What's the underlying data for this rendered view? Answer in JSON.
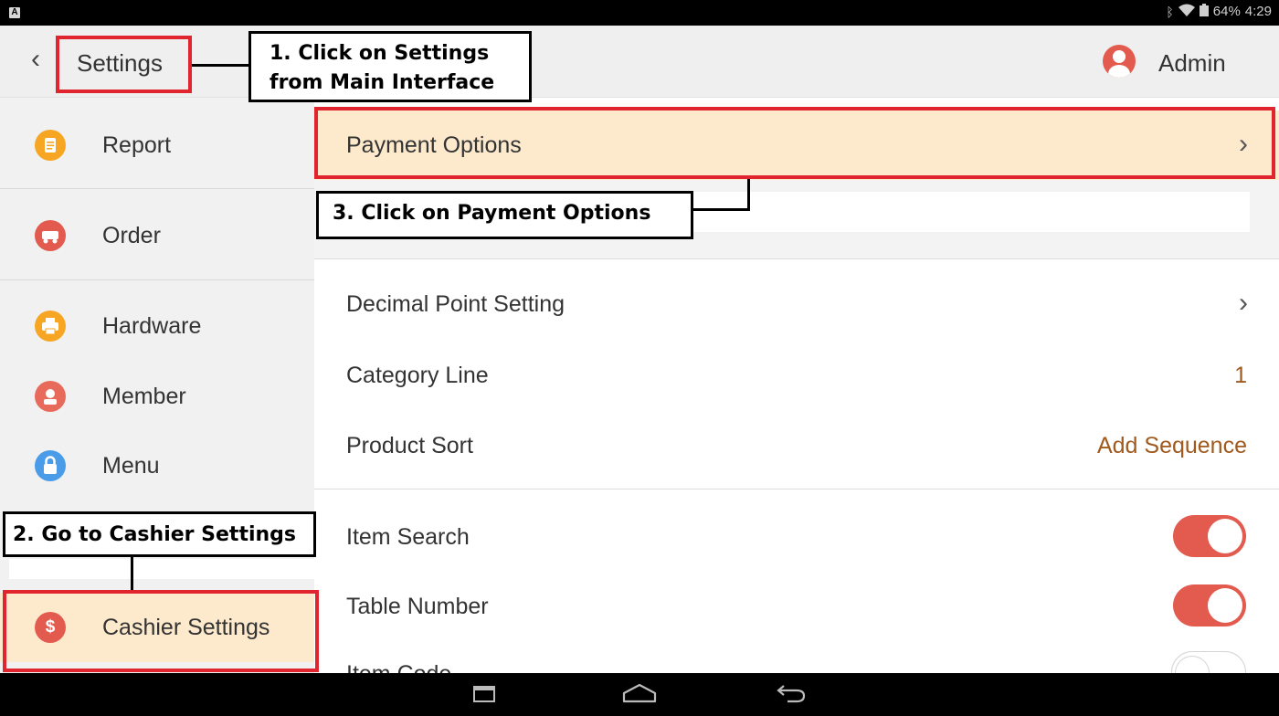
{
  "status_bar": {
    "battery": "64%",
    "time": "4:29",
    "notification_glyph": "A"
  },
  "header": {
    "back_icon": "‹",
    "title": "Settings",
    "user_name": "Admin"
  },
  "sidebar": {
    "items": [
      {
        "label": "Report",
        "icon": "report-icon",
        "color": "#f6a623",
        "glyph": "≡"
      },
      {
        "label": "Order",
        "icon": "order-icon",
        "color": "#e25b4e",
        "glyph": "✦"
      },
      {
        "label": "Hardware",
        "icon": "printer-icon",
        "color": "#f6a623",
        "glyph": "▤"
      },
      {
        "label": "Member",
        "icon": "member-icon",
        "color": "#e86a5a",
        "glyph": "♚"
      },
      {
        "label": "Menu",
        "icon": "menu-lock-icon",
        "color": "#4a9ce8",
        "glyph": "🔒"
      },
      {
        "label": "Cashier Settings",
        "icon": "dollar-icon",
        "color": "#e25b4e",
        "glyph": "$"
      }
    ]
  },
  "main": {
    "payment_options": "Payment Options",
    "decimal_point": "Decimal Point Setting",
    "category_line": {
      "label": "Category Line",
      "value": "1"
    },
    "product_sort": {
      "label": "Product Sort",
      "value": "Add Sequence"
    },
    "item_search": {
      "label": "Item Search",
      "toggle": "on"
    },
    "table_number": {
      "label": "Table Number",
      "toggle": "on"
    },
    "item_code": {
      "label": "Item Code",
      "toggle": "off"
    },
    "chevron": "›"
  },
  "annotations": {
    "step1_line1": "1. Click on Settings",
    "step1_line2": "from Main Interface",
    "step2": "2. Go to Cashier Settings",
    "step3": "3. Click on Payment Options"
  },
  "colors": {
    "accent": "#e25b4e",
    "highlight": "#fde9cc",
    "annotation_red": "#e0252f",
    "value_brown": "#a05a1e"
  }
}
